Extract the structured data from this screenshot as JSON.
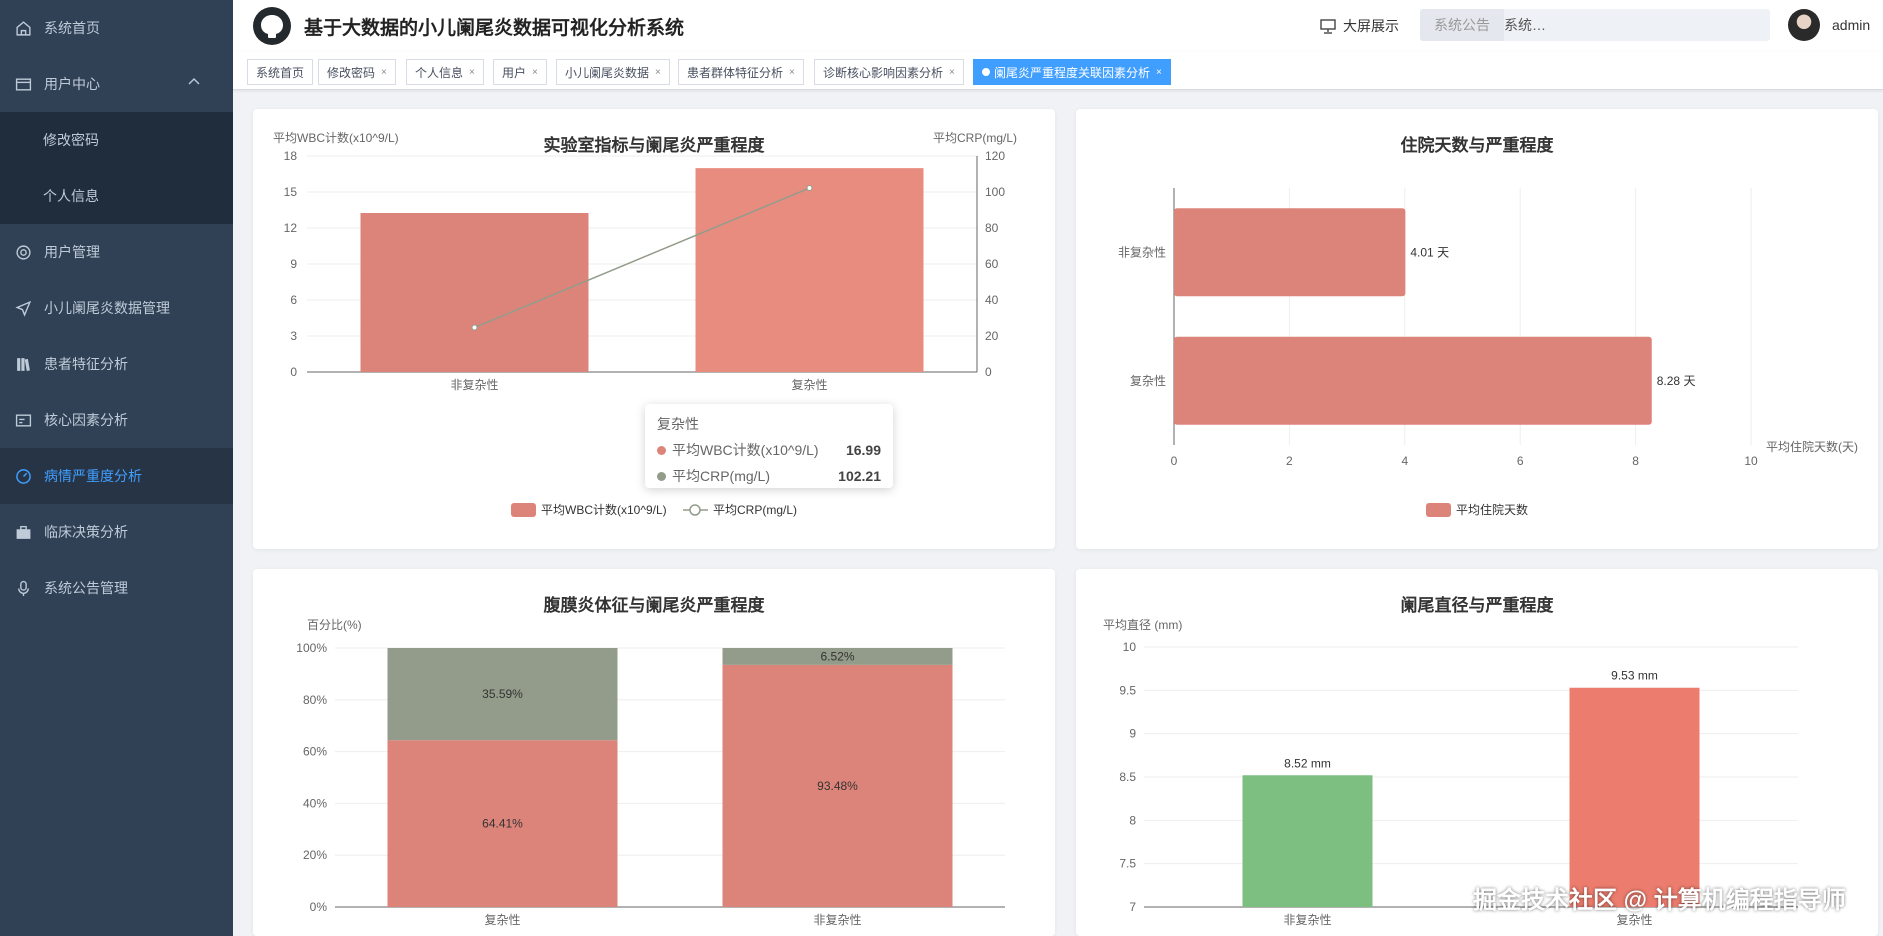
{
  "app": {
    "title": "基于大数据的小儿阑尾炎数据可视化分析系统",
    "big_screen": "大屏展示",
    "notice_label": "系统公告",
    "notice_text": "系统…",
    "user": "admin"
  },
  "sidebar": {
    "items": [
      {
        "label": "系统首页",
        "icon": "home-icon"
      },
      {
        "label": "用户中心",
        "icon": "user-center-icon"
      },
      {
        "label": "修改密码"
      },
      {
        "label": "个人信息"
      },
      {
        "label": "用户管理",
        "icon": "lifebuoy-icon"
      },
      {
        "label": "小儿阑尾炎数据管理",
        "icon": "send-icon"
      },
      {
        "label": "患者特征分析",
        "icon": "books-icon"
      },
      {
        "label": "核心因素分析",
        "icon": "card-icon"
      },
      {
        "label": "病情严重度分析",
        "icon": "gauge-icon"
      },
      {
        "label": "临床决策分析",
        "icon": "briefcase-icon"
      },
      {
        "label": "系统公告管理",
        "icon": "microphone-icon"
      }
    ]
  },
  "tags": [
    "系统首页",
    "修改密码",
    "个人信息",
    "用户",
    "小儿阑尾炎数据",
    "患者群体特征分析",
    "诊断核心影响因素分析",
    "阑尾炎严重程度关联因素分析"
  ],
  "colors": {
    "accent": "#409eff",
    "sidebar": "#304156",
    "bar_red": "#dd847a",
    "bar_gray": "#939c8a",
    "bar_green": "#7cbf80",
    "bar_salmon": "#ec7c6e"
  },
  "tooltip": {
    "title": "复杂性",
    "rows": [
      {
        "name": "平均WBC计数(x10^9/L)",
        "value": "16.99"
      },
      {
        "name": "平均CRP(mg/L)",
        "value": "102.21"
      }
    ]
  },
  "chart_data": [
    {
      "type": "bar",
      "title": "实验室指标与阑尾炎严重程度",
      "categories": [
        "非复杂性",
        "复杂性"
      ],
      "y_left_label": "平均WBC计数(x10^9/L)",
      "y_right_label": "平均CRP(mg/L)",
      "y_left_ticks": [
        "0",
        "3",
        "6",
        "9",
        "12",
        "15",
        "18"
      ],
      "y_right_ticks": [
        "0",
        "20",
        "40",
        "60",
        "80",
        "100",
        "120"
      ],
      "ylim_left": [
        0,
        18
      ],
      "ylim_right": [
        0,
        120
      ],
      "series": [
        {
          "name": "平均WBC计数(x10^9/L)",
          "type": "bar",
          "values": [
            13.25,
            16.99
          ]
        },
        {
          "name": "平均CRP(mg/L)",
          "type": "line",
          "values": [
            24.7,
            102.21
          ]
        }
      ],
      "legend": "bottom"
    },
    {
      "type": "bar",
      "orientation": "horizontal",
      "title": "住院天数与严重程度",
      "categories": [
        "非复杂性",
        "复杂性"
      ],
      "x_label": "平均住院天数(天)",
      "x_ticks": [
        "0",
        "2",
        "4",
        "6",
        "8",
        "10"
      ],
      "xlim": [
        0,
        10
      ],
      "series": [
        {
          "name": "平均住院天数",
          "values": [
            4.01,
            8.28
          ],
          "labels": [
            "4.01 天",
            "8.28 天"
          ]
        }
      ],
      "legend": "bottom"
    },
    {
      "type": "bar",
      "stacked": true,
      "title": "腹膜炎体征与阑尾炎严重程度",
      "ylabel": "百分比(%)",
      "y_ticks": [
        "0%",
        "20%",
        "40%",
        "60%",
        "80%",
        "100%"
      ],
      "ylim": [
        0,
        100
      ],
      "categories": [
        "复杂性",
        "非复杂性"
      ],
      "series": [
        {
          "values": [
            64.41,
            93.48
          ],
          "labels": [
            "64.41%",
            "93.48%"
          ]
        },
        {
          "values": [
            35.59,
            6.52
          ],
          "labels": [
            "35.59%",
            "6.52%"
          ]
        }
      ]
    },
    {
      "type": "bar",
      "title": "阑尾直径与严重程度",
      "ylabel": "平均直径 (mm)",
      "y_ticks": [
        "7",
        "7.5",
        "8",
        "8.5",
        "9",
        "9.5",
        "10"
      ],
      "ylim": [
        7,
        10
      ],
      "categories": [
        "非复杂性",
        "复杂性"
      ],
      "series": [
        {
          "values": [
            8.52,
            9.53
          ],
          "labels": [
            "8.52 mm",
            "9.53 mm"
          ]
        }
      ]
    }
  ],
  "watermark": "掘金技术社区 @ 计算机编程指导师"
}
